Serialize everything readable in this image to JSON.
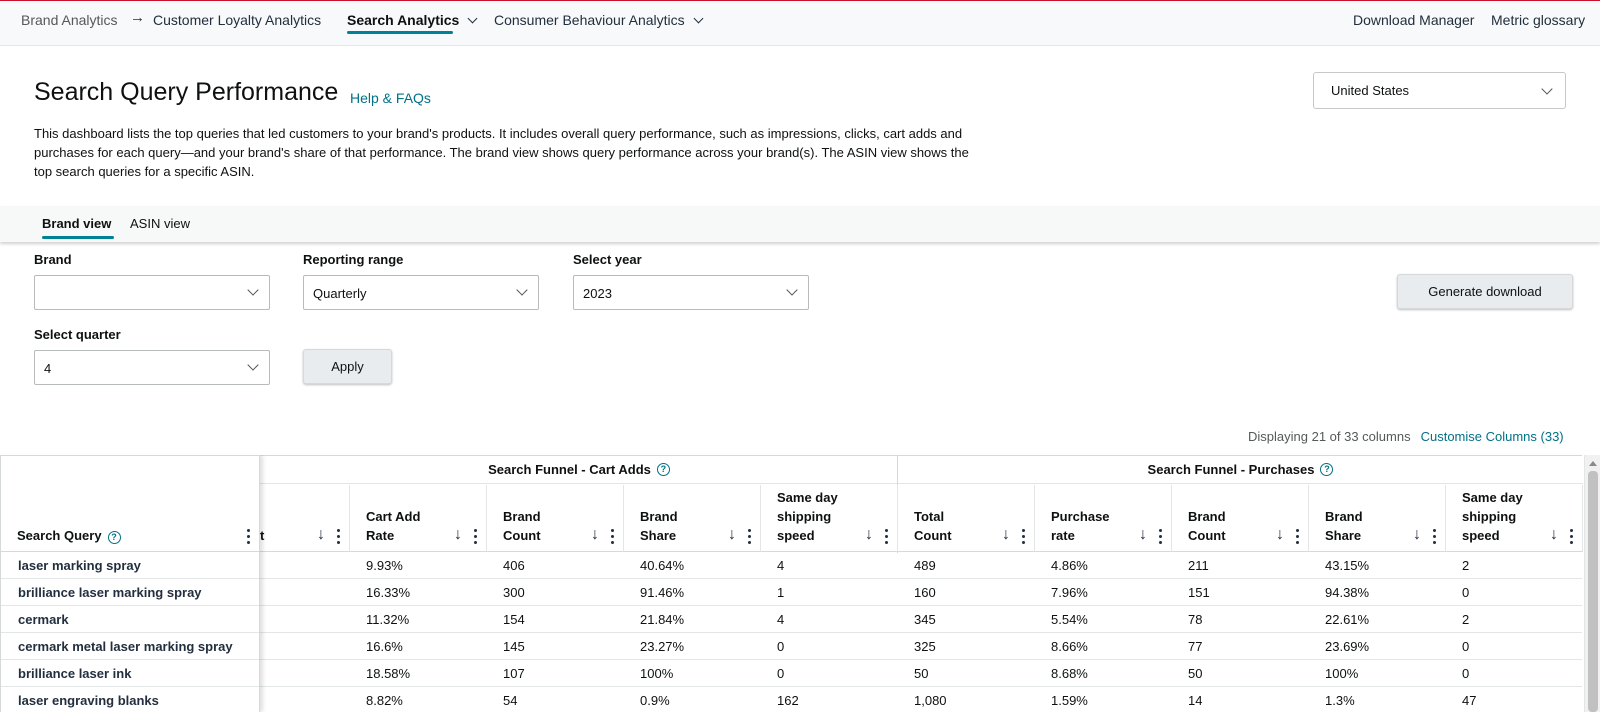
{
  "nav": {
    "breadcrumb_root": "Brand Analytics",
    "crumb_arrow": "→",
    "customer_loyalty": "Customer Loyalty Analytics",
    "search_analytics": "Search Analytics",
    "consumer_behaviour": "Consumer Behaviour Analytics",
    "download_manager": "Download Manager",
    "metric_glossary": "Metric glossary"
  },
  "header": {
    "title": "Search Query Performance",
    "help_link": "Help & FAQs",
    "description": "This dashboard lists the top queries that led customers to your brand's products. It includes overall query performance, such as impressions, clicks, cart adds and purchases for each query—and your brand's share of that performance. The brand view shows query performance across your brand(s). The ASIN view shows the top search queries for a specific ASIN.",
    "country": "United States"
  },
  "view_tabs": [
    "Brand view",
    "ASIN view"
  ],
  "filters": {
    "brand_label": "Brand",
    "brand_value": "",
    "range_label": "Reporting range",
    "range_value": "Quarterly",
    "year_label": "Select year",
    "year_value": "2023",
    "quarter_label": "Select quarter",
    "quarter_value": "4",
    "apply": "Apply",
    "generate_download": "Generate download"
  },
  "columns_info": {
    "displaying": "Displaying 21 of 33 columns",
    "customise": "Customise Columns (33)"
  },
  "table": {
    "query_header": "Search Query",
    "cut_header_fragment": "t",
    "groups": [
      "Search Funnel - Cart Adds",
      "Search Funnel - Purchases"
    ],
    "headers": [
      [
        "Cart Add",
        "Rate"
      ],
      [
        "Brand",
        "Count"
      ],
      [
        "Brand",
        "Share"
      ],
      [
        "Same day",
        "shipping",
        "speed"
      ],
      [
        "Total",
        "Count"
      ],
      [
        "Purchase",
        "rate"
      ],
      [
        "Brand",
        "Count"
      ],
      [
        "Brand",
        "Share"
      ],
      [
        "Same day",
        "shipping",
        "speed"
      ]
    ],
    "rows": [
      {
        "query": "laser marking spray",
        "cells": [
          "9.93%",
          "406",
          "40.64%",
          "4",
          "489",
          "4.86%",
          "211",
          "43.15%",
          "2"
        ]
      },
      {
        "query": "brilliance laser marking spray",
        "cells": [
          "16.33%",
          "300",
          "91.46%",
          "1",
          "160",
          "7.96%",
          "151",
          "94.38%",
          "0"
        ]
      },
      {
        "query": "cermark",
        "cells": [
          "11.32%",
          "154",
          "21.84%",
          "4",
          "345",
          "5.54%",
          "78",
          "22.61%",
          "2"
        ]
      },
      {
        "query": "cermark metal laser marking spray",
        "cells": [
          "16.6%",
          "145",
          "23.27%",
          "0",
          "325",
          "8.66%",
          "77",
          "23.69%",
          "0"
        ]
      },
      {
        "query": "brilliance laser ink",
        "cells": [
          "18.58%",
          "107",
          "100%",
          "0",
          "50",
          "8.68%",
          "50",
          "100%",
          "0"
        ]
      },
      {
        "query": "laser engraving blanks",
        "cells": [
          "8.82%",
          "54",
          "0.9%",
          "162",
          "1,080",
          "1.59%",
          "14",
          "1.3%",
          "47"
        ]
      }
    ]
  }
}
